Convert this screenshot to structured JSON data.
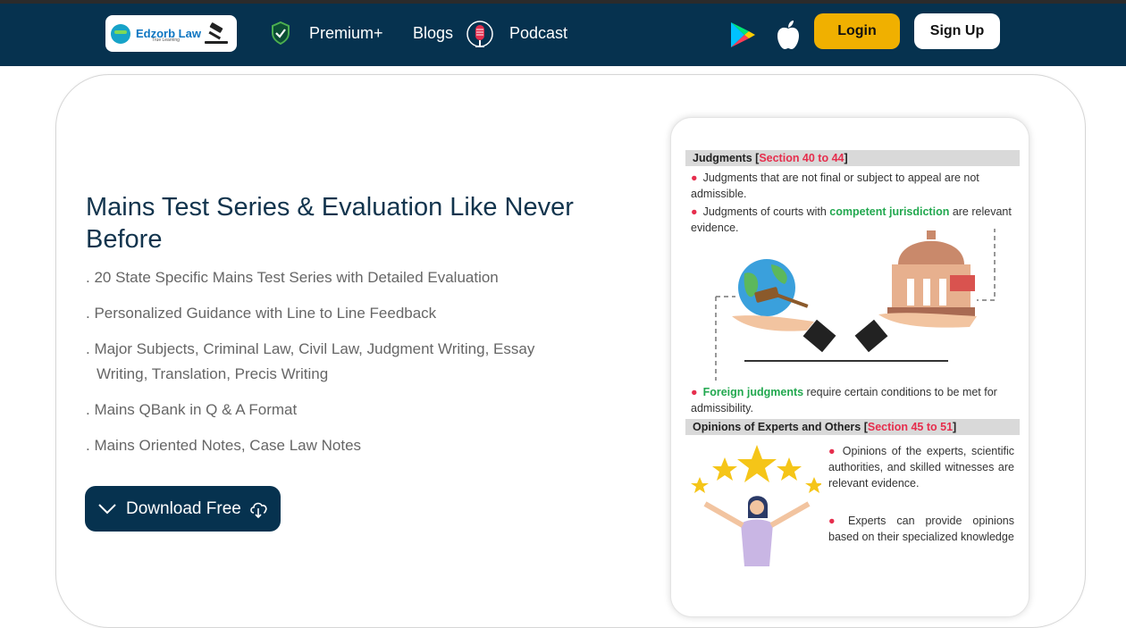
{
  "header": {
    "logo": {
      "name": "Edzorb Law",
      "tagline": "True Learning"
    },
    "nav": [
      {
        "label": "Premium+"
      },
      {
        "label": "Blogs"
      },
      {
        "label": "Podcast"
      }
    ],
    "login_label": "Login",
    "signup_label": "Sign Up"
  },
  "hero": {
    "title": "Mains Test Series & Evaluation Like Never Before",
    "features": [
      ". 20 State Specific Mains Test Series with Detailed Evaluation",
      ". Personalized Guidance with Line to Line Feedback",
      ". Major Subjects, Criminal Law, Civil Law, Judgment Writing, Essay",
      "Writing, Translation, Precis Writing",
      ". Mains QBank in Q & A Format",
      ". Mains Oriented Notes, Case Law Notes"
    ],
    "download_label": "Download Free"
  },
  "info_card": {
    "section1": {
      "title": "Judgments [",
      "ref": "Section 40 to 44",
      "close": "]"
    },
    "b1": "Judgments that are not final or subject to appeal are not admissible.",
    "b2_pre": "Judgments of courts with ",
    "b2_green": "competent jurisdiction",
    "b2_post": " are relevant evidence.",
    "b3_green": "Foreign judgments",
    "b3_post": " require certain conditions to be met for admissibility.",
    "section2": {
      "title": "Opinions of Experts and Others [",
      "ref": "Section 45 to 51",
      "close": "]"
    },
    "r1": "Opinions of the experts, scientific authorities, and skilled witnesses are relevant evidence.",
    "r2": "Experts can provide opinions based on their specialized knowledge"
  },
  "colors": {
    "navy": "#06324f",
    "login_yellow": "#f0b000",
    "accent_red": "#e62e4d",
    "accent_green": "#22a84f"
  }
}
